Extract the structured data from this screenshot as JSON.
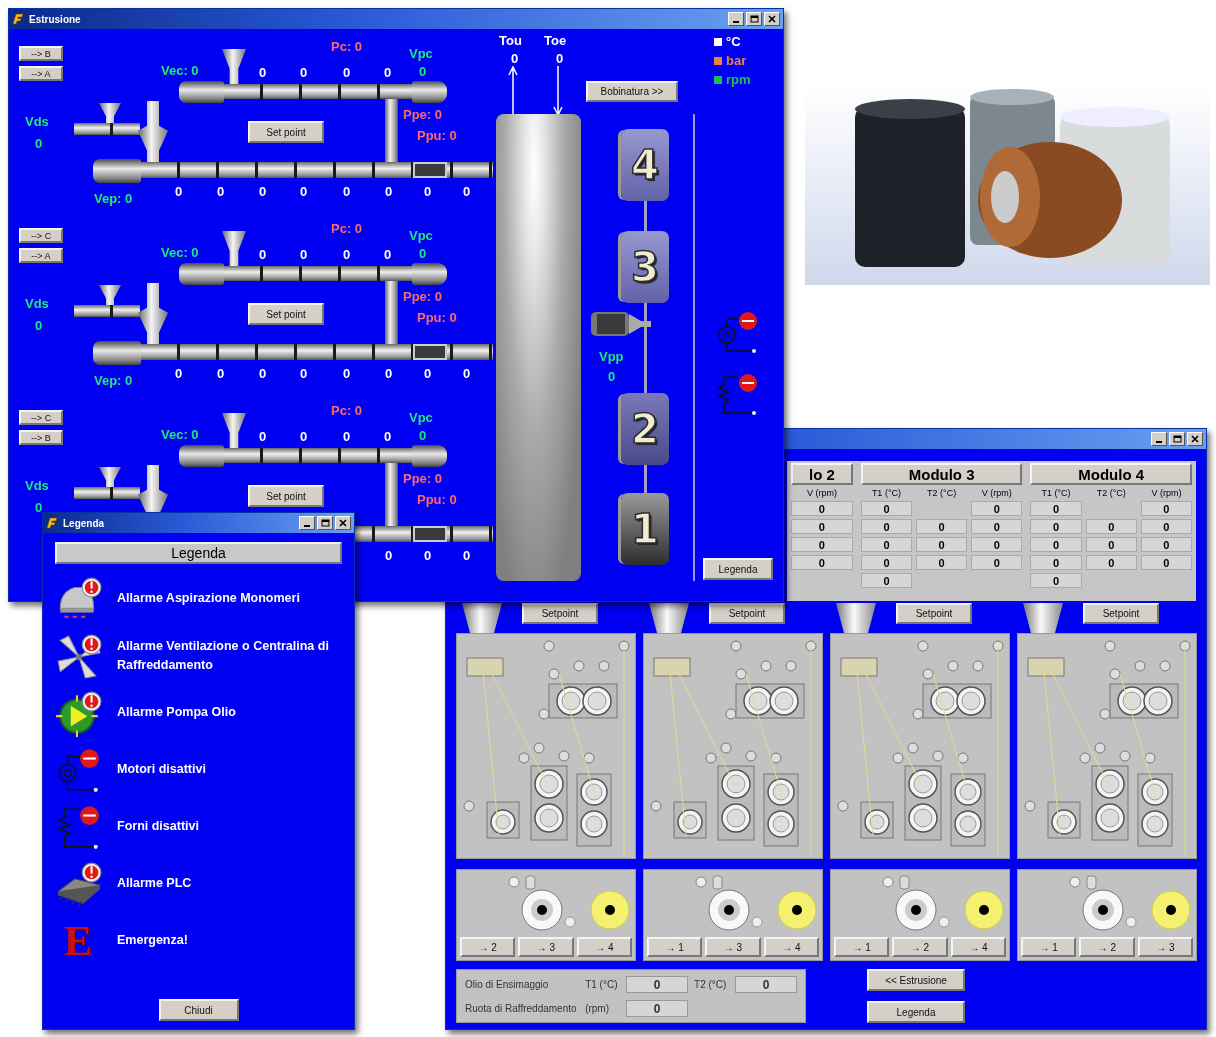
{
  "extrusion_window": {
    "title": "Estrusione",
    "lines": [
      {
        "buttons": [
          "--> B",
          "--> A"
        ],
        "vds_label": "Vds",
        "vds_value": "0",
        "vec": "Vec: 0",
        "pc": "Pc: 0",
        "vpc_label": "Vpc",
        "vpc_value": "0",
        "upper_values": [
          "0",
          "0",
          "0",
          "0"
        ],
        "setpoint_button": "Set point",
        "ppe": "Ppe: 0",
        "ppu": "Ppu: 0",
        "lower_values": [
          "0",
          "0",
          "0",
          "0",
          "0",
          "0",
          "0",
          "0"
        ],
        "vep": "Vep: 0"
      },
      {
        "buttons": [
          "--> C",
          "--> A"
        ],
        "vds_label": "Vds",
        "vds_value": "0",
        "vec": "Vec: 0",
        "pc": "Pc: 0",
        "vpc_label": "Vpc",
        "vpc_value": "0",
        "upper_values": [
          "0",
          "0",
          "0",
          "0"
        ],
        "setpoint_button": "Set point",
        "ppe": "Ppe: 0",
        "ppu": "Ppu: 0",
        "lower_values": [
          "0",
          "0",
          "0",
          "0",
          "0",
          "0",
          "0",
          "0"
        ],
        "vep": "Vep: 0"
      },
      {
        "buttons": [
          "--> C",
          "--> B"
        ],
        "vds_label": "Vds",
        "vds_value": "0",
        "vec": "Vec: 0",
        "pc": "Pc: 0",
        "vpc_label": "Vpc",
        "vpc_value": "0",
        "upper_values": [
          "0",
          "0",
          "0",
          "0"
        ],
        "setpoint_button": "Set point",
        "ppe": "Ppe: 0",
        "ppu": "Ppu: 0",
        "lower_values": [
          "0",
          "0",
          "0"
        ]
      }
    ],
    "tou_label": "Tou",
    "tou_value": "0",
    "toe_label": "Toe",
    "toe_value": "0",
    "winding_button": "Bobinatura >>",
    "units": [
      {
        "label": "°C",
        "color": "#ffffff"
      },
      {
        "label": "bar",
        "color": "#f08040"
      },
      {
        "label": "rpm",
        "color": "#20c050"
      }
    ],
    "modules": [
      {
        "label": "4",
        "kind": "light"
      },
      {
        "label": "3",
        "kind": "light"
      },
      {
        "label": "2",
        "kind": "medium"
      },
      {
        "label": "1",
        "kind": "dark"
      }
    ],
    "vpp_label": "Vpp",
    "vpp_value": "0",
    "legend_button": "Legenda"
  },
  "winding_window": {
    "modules": [
      {
        "title": "lo 2",
        "columns": [
          "V (rpm)"
        ],
        "rows": [
          [
            "0"
          ],
          [
            "0"
          ],
          [
            "0"
          ],
          [
            "0"
          ]
        ]
      },
      {
        "title": "Modulo 3",
        "columns": [
          "T1 (°C)",
          "T2 (°C)",
          "V (rpm)"
        ],
        "rows": [
          [
            "0",
            null,
            "0"
          ],
          [
            "0",
            "0",
            "0"
          ],
          [
            "0",
            "0",
            "0"
          ],
          [
            "0",
            "0",
            "0"
          ],
          [
            "0"
          ]
        ]
      },
      {
        "title": "Modulo 4",
        "columns": [
          "T1 (°C)",
          "T2 (°C)",
          "V (rpm)"
        ],
        "rows": [
          [
            "0",
            null,
            "0"
          ],
          [
            "0",
            "0",
            "0"
          ],
          [
            "0",
            "0",
            "0"
          ],
          [
            "0",
            "0",
            "0"
          ],
          [
            "0"
          ]
        ]
      }
    ],
    "stations": [
      {
        "setpoint_button": "Setpoint",
        "transfer_buttons": [
          "→ 2",
          "→ 3",
          "→ 4"
        ]
      },
      {
        "setpoint_button": "Setpoint",
        "transfer_buttons": [
          "→ 1",
          "→ 3",
          "→ 4"
        ]
      },
      {
        "setpoint_button": "Setpoint",
        "transfer_buttons": [
          "→ 1",
          "→ 2",
          "→ 4"
        ]
      },
      {
        "setpoint_button": "Setpoint",
        "transfer_buttons": [
          "→ 1",
          "→ 2",
          "→ 3"
        ]
      }
    ],
    "oil_label": "Olio di Ensimaggio",
    "t1_label": "T1 (°C)",
    "t1_value": "0",
    "t2_label": "T2 (°C)",
    "t2_value": "0",
    "wheel_label": "Ruota di Raffreddamento",
    "rpm_label": "(rpm)",
    "rpm_value": "0",
    "back_button": "<< Estrusione",
    "legend_button": "Legenda"
  },
  "legend_window": {
    "title": "Legenda",
    "header": "Legenda",
    "items": [
      {
        "kind": "suction",
        "text": "Allarme Aspirazione Monomeri"
      },
      {
        "kind": "fan",
        "text": "Allarme Ventilazione o Centralina di Raffreddamento"
      },
      {
        "kind": "pump",
        "text": "Allarme Pompa Olio"
      },
      {
        "kind": "motor",
        "text": "Motori disattivi"
      },
      {
        "kind": "oven",
        "text": "Forni disattivi"
      },
      {
        "kind": "plc",
        "text": "Allarme PLC"
      },
      {
        "kind": "emergency",
        "symbol": "E",
        "text": "Emergenza!"
      }
    ],
    "close_button": "Chiudi"
  }
}
